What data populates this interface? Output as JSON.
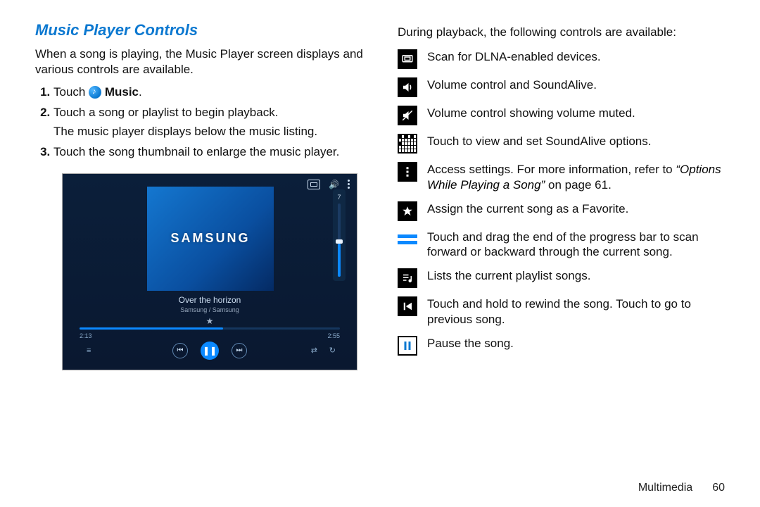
{
  "header": {
    "title": "Music Player Controls"
  },
  "intro": "When a song is playing, the Music Player screen displays and various controls are available.",
  "steps": {
    "s1_prefix": "Touch ",
    "s1_suffix": "Music",
    "s1_period": ".",
    "s2": "Touch a song or playlist to begin playback.",
    "s2b": "The music player displays below the music listing.",
    "s3": "Touch the song thumbnail to enlarge the music player."
  },
  "right_intro": "During playback, the following controls are available:",
  "legend": {
    "dlna": "Scan for DLNA-enabled devices.",
    "volume": "Volume control and SoundAlive.",
    "muted": "Volume control showing volume muted.",
    "soundalive": "Touch to view and set SoundAlive options.",
    "settings_a": "Access settings. For more information, refer to ",
    "settings_b": "“Options While Playing a Song”",
    "settings_c": " on page 61.",
    "favorite": "Assign the current song as a Favorite.",
    "progress": "Touch and drag the end of the progress bar to scan forward or backward through the current song.",
    "playlist": "Lists the current playlist songs.",
    "prev": "Touch and hold to rewind the song. Touch to go to previous song.",
    "pause": "Pause the song."
  },
  "player": {
    "brand": "SAMSUNG",
    "volume_level": "7",
    "song_title": "Over the horizon",
    "song_artist": "Samsung / Samsung",
    "time_elapsed": "2:13",
    "time_total": "2:55"
  },
  "footer": {
    "section": "Multimedia",
    "page": "60"
  }
}
